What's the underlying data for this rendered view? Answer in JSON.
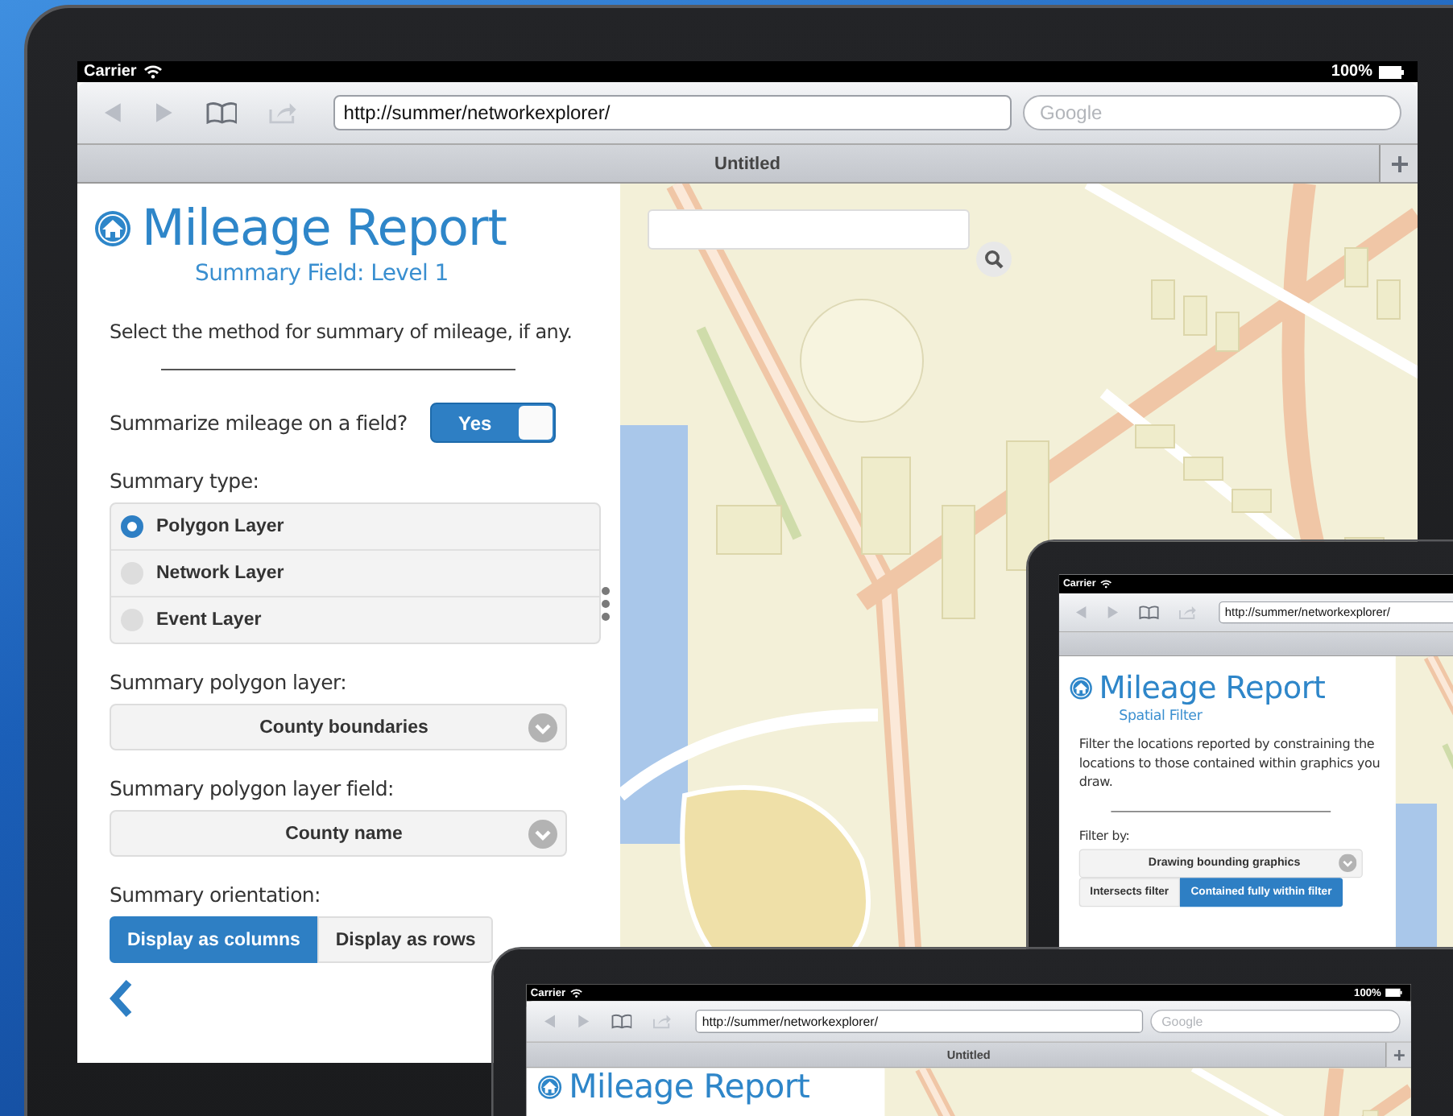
{
  "main_tablet": {
    "status_bar": {
      "carrier": "Carrier",
      "battery": "100%"
    },
    "browser": {
      "url": "http://summer/networkexplorer/",
      "search_placeholder": "Google",
      "tab_title": "Untitled"
    },
    "panel": {
      "title": "Mileage Report",
      "subtitle": "Summary Field: Level 1",
      "description": "Select the method for summary of mileage, if any.",
      "fields": [
        {
          "kind": "toggle",
          "label": "Summarize mileage on a field?",
          "value": "Yes",
          "on": true
        },
        {
          "kind": "radio",
          "label": "Summary type:",
          "options": [
            {
              "label": "Polygon Layer",
              "selected": true
            },
            {
              "label": "Network Layer",
              "selected": false
            },
            {
              "label": "Event Layer",
              "selected": false
            }
          ]
        },
        {
          "kind": "select",
          "label": "Summary polygon layer:",
          "value": "County boundaries"
        },
        {
          "kind": "select",
          "label": "Summary polygon layer field:",
          "value": "County name"
        },
        {
          "kind": "segmented",
          "label": "Summary orientation:",
          "options": [
            {
              "label": "Display as columns",
              "selected": true
            },
            {
              "label": "Display as rows",
              "selected": false
            }
          ]
        }
      ]
    }
  },
  "second_tablet": {
    "status_bar": {
      "carrier": "Carrier"
    },
    "browser": {
      "url": "http://summer/networkexplorer/"
    },
    "panel": {
      "title": "Mileage Report",
      "subtitle": "Spatial Filter",
      "description": "Filter the locations reported by constraining the locations to those contained within graphics you draw.",
      "fields": [
        {
          "kind": "select",
          "label": "Filter by:",
          "value": "Drawing bounding graphics"
        },
        {
          "kind": "segmented",
          "options": [
            {
              "label": "Intersects filter",
              "selected": false
            },
            {
              "label": "Contained fully within filter",
              "selected": true
            }
          ]
        }
      ]
    }
  },
  "third_tablet": {
    "status_bar": {
      "carrier": "Carrier",
      "battery": "100%"
    },
    "browser": {
      "url": "http://summer/networkexplorer/",
      "search_placeholder": "Google",
      "tab_title": "Untitled"
    },
    "panel": {
      "title": "Mileage Report"
    }
  }
}
